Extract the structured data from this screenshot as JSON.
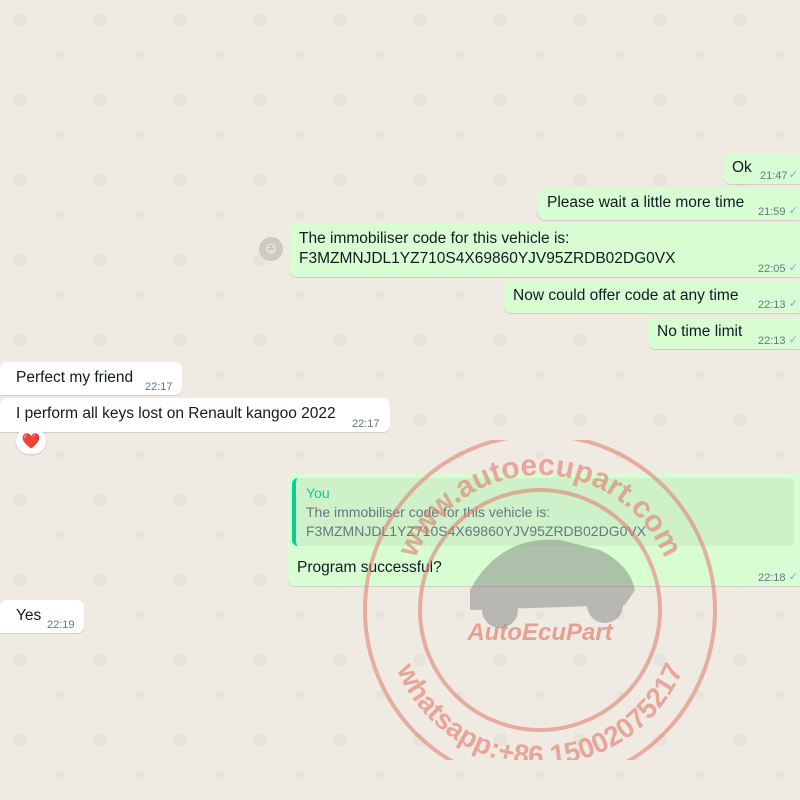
{
  "messages": [
    {
      "text": "Ok",
      "time": "21:47"
    },
    {
      "text": "Please wait a little more time",
      "time": "21:59"
    },
    {
      "text_line1": "The immobiliser code for this vehicle is:",
      "text_line2": "F3MZMNJDL1YZ710S4X69860YJV95ZRDB02DG0VX",
      "time": "22:05"
    },
    {
      "text": "Now could offer code at any time",
      "time": "22:13"
    },
    {
      "text": "No time limit",
      "time": "22:13"
    },
    {
      "text": "Perfect my friend",
      "time": "22:17"
    },
    {
      "text": "I perform all keys lost on Renault kangoo 2022",
      "time": "22:17"
    },
    {
      "quote_author": "You",
      "quote_line1": "The immobiliser code for this vehicle is:",
      "quote_line2": "F3MZMNJDL1YZ710S4X69860YJV95ZRDB02DG0VX",
      "text": "Program successful?",
      "time": "22:18"
    },
    {
      "text": "Yes",
      "time": "22:19"
    }
  ],
  "reaction": {
    "emoji": "❤️"
  },
  "icons": {
    "read": "double-check-icon",
    "react": "smiley-icon"
  },
  "watermark": {
    "site": "www.autoecupart.com",
    "brand": "AutoEcuPart",
    "phone": "whatsapp:+86 15002075217",
    "color": "#e4786b"
  },
  "colors": {
    "outgoing": "#d9fdd3",
    "incoming": "#ffffff",
    "background": "#efeae2",
    "tick": "#53bdeb",
    "quote_bar": "#06cf9c"
  }
}
